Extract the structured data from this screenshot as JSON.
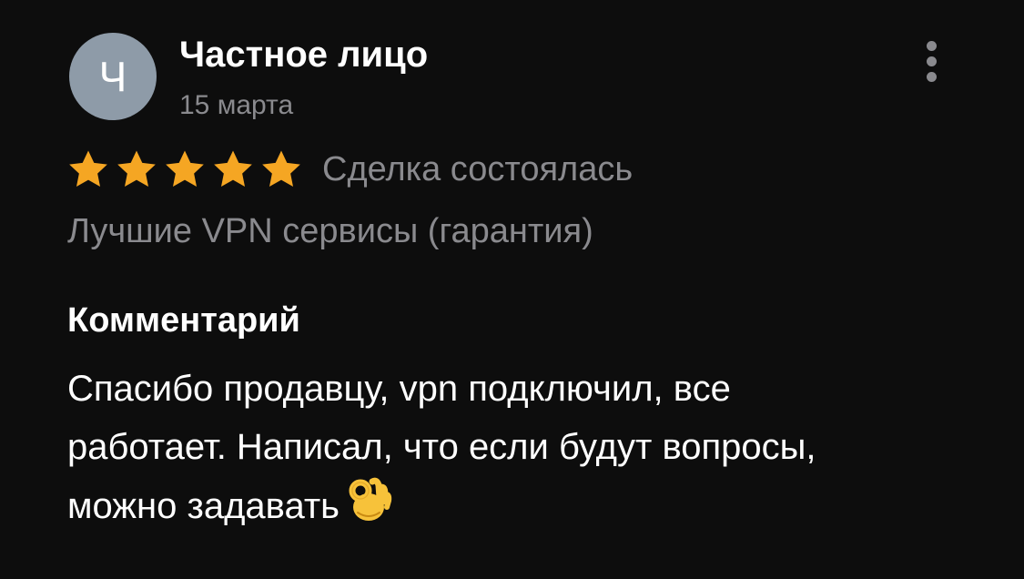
{
  "review": {
    "author": {
      "initial": "Ч",
      "name": "Частное лицо",
      "avatar_color": "#8e9ba8"
    },
    "date": "15 марта",
    "more_icon": "more-vertical-icon",
    "rating": 5,
    "max_rating": 5,
    "star_color": "#f5a623",
    "deal_status": "Сделка состоялась",
    "product": "Лучшие VPN сервисы (гарантия)",
    "comment_heading": "Комментарий",
    "comment_lines": [
      "Спасибо продавцу, vpn подключил, все",
      "работает. Написал, что если будут вопросы,",
      "можно задавать"
    ],
    "comment_emoji": "ok-hand-emoji"
  }
}
